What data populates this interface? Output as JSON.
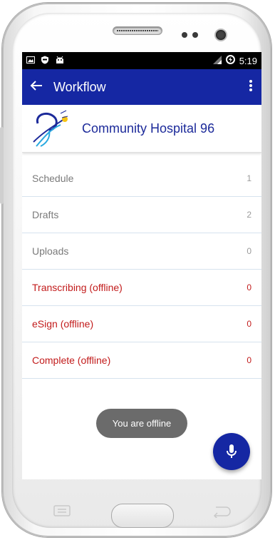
{
  "status_bar": {
    "time": "5:19",
    "left_icons": [
      "image-icon",
      "shield-icon",
      "android-icon"
    ],
    "right_icons": [
      "signal-icon",
      "data-saver-icon"
    ]
  },
  "app_bar": {
    "title": "Workflow",
    "back_icon": "arrow-back-icon",
    "menu_icon": "more-vert-icon",
    "color": "#1527a3"
  },
  "hospital": {
    "name": "Community Hospital 96",
    "logo": "hospital-logo-icon"
  },
  "list": {
    "items": [
      {
        "label": "Schedule",
        "count": "1",
        "offline": false
      },
      {
        "label": "Drafts",
        "count": "2",
        "offline": false
      },
      {
        "label": "Uploads",
        "count": "0",
        "offline": false
      },
      {
        "label": "Transcribing (offline)",
        "count": "0",
        "offline": true
      },
      {
        "label": "eSign (offline)",
        "count": "0",
        "offline": true
      },
      {
        "label": "Complete (offline)",
        "count": "0",
        "offline": true
      }
    ]
  },
  "toast": {
    "text": "You are offline"
  },
  "fab": {
    "icon": "mic-icon"
  },
  "colors": {
    "offline": "#c21b1b",
    "accent": "#1527a3"
  }
}
